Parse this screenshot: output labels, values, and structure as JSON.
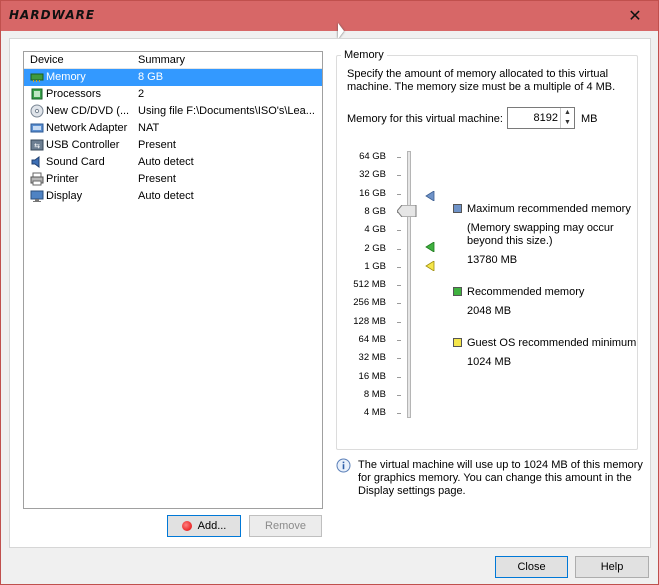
{
  "window": {
    "title": "HARDWARE",
    "close_glyph": "✕"
  },
  "device_list": {
    "headers": {
      "device": "Device",
      "summary": "Summary"
    },
    "rows": [
      {
        "icon": "memory-icon",
        "device": "Memory",
        "summary": "8 GB",
        "selected": true
      },
      {
        "icon": "processor-icon",
        "device": "Processors",
        "summary": "2"
      },
      {
        "icon": "cd-dvd-icon",
        "device": "New CD/DVD (...",
        "summary": "Using file F:\\Documents\\ISO's\\Lea..."
      },
      {
        "icon": "network-adapter-icon",
        "device": "Network Adapter",
        "summary": "NAT"
      },
      {
        "icon": "usb-icon",
        "device": "USB Controller",
        "summary": "Present"
      },
      {
        "icon": "sound-card-icon",
        "device": "Sound Card",
        "summary": "Auto detect"
      },
      {
        "icon": "printer-icon",
        "device": "Printer",
        "summary": "Present"
      },
      {
        "icon": "display-icon",
        "device": "Display",
        "summary": "Auto detect"
      }
    ]
  },
  "buttons": {
    "add": "Add...",
    "remove": "Remove",
    "close": "Close",
    "help": "Help"
  },
  "memory": {
    "group_label": "Memory",
    "description": "Specify the amount of memory allocated to this virtual machine. The memory size must be a multiple of 4 MB.",
    "field_label": "Memory for this virtual machine:",
    "value": "8192",
    "unit": "MB",
    "scale_labels": [
      "64 GB",
      "32 GB",
      "16 GB",
      "8 GB",
      "4 GB",
      "2 GB",
      "1 GB",
      "512 MB",
      "256 MB",
      "128 MB",
      "64 MB",
      "32 MB",
      "16 MB",
      "8 MB",
      "4 MB"
    ],
    "legend": {
      "max": {
        "label": "Maximum recommended memory",
        "note": "(Memory swapping may occur beyond this size.)",
        "value": "13780 MB",
        "color": "#6f93c8"
      },
      "recommended": {
        "label": "Recommended memory",
        "value": "2048 MB",
        "color": "#3fb13f"
      },
      "guest_min": {
        "label": "Guest OS recommended minimum",
        "value": "1024 MB",
        "color": "#f5e64a"
      }
    },
    "info": "The virtual machine will use up to 1024 MB of this memory for graphics memory. You can change this amount in the Display settings page."
  }
}
